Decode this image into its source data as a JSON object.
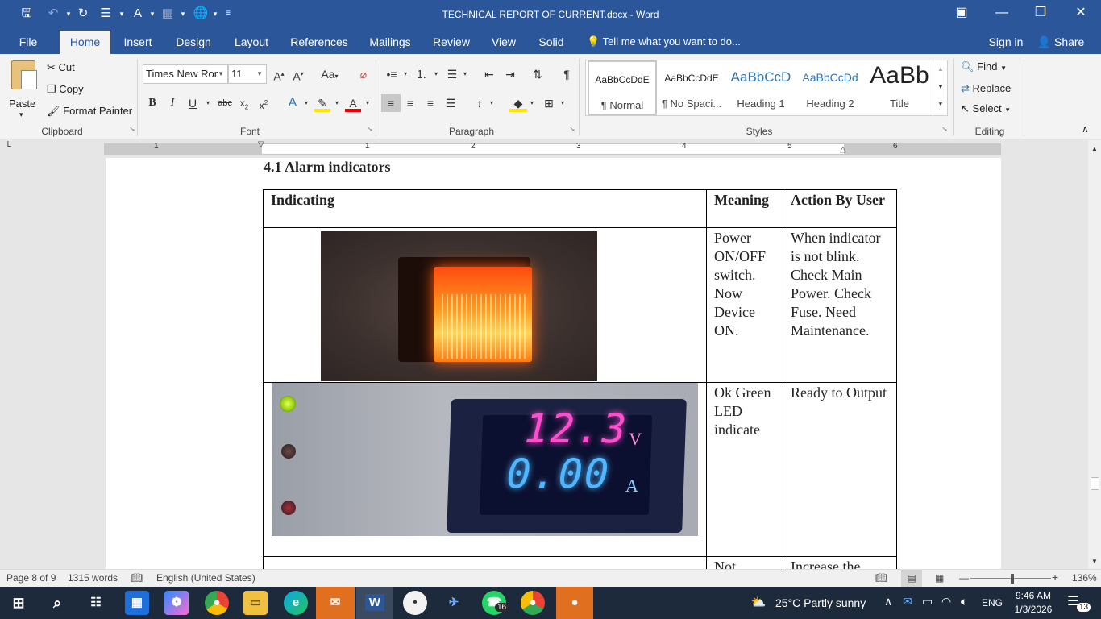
{
  "window": {
    "title": "TECHNICAL REPORT OF CURRENT.docx - Word"
  },
  "tabs": [
    "File",
    "Home",
    "Insert",
    "Design",
    "Layout",
    "References",
    "Mailings",
    "Review",
    "View",
    "Solid"
  ],
  "tell_me": "Tell me what you want to do...",
  "sign_in": "Sign in",
  "share": "Share",
  "clipboard": {
    "paste": "Paste",
    "cut": "Cut",
    "copy": "Copy",
    "format_painter": "Format Painter",
    "label": "Clipboard"
  },
  "font": {
    "name": "Times New Ror",
    "size": "11",
    "label": "Font"
  },
  "paragraph": {
    "label": "Paragraph"
  },
  "styles": {
    "label": "Styles",
    "items": [
      {
        "preview": "AaBbCcDdE",
        "name": "¶ Normal"
      },
      {
        "preview": "AaBbCcDdE",
        "name": "¶ No Spaci..."
      },
      {
        "preview": "AaBbCcD",
        "name": "Heading 1"
      },
      {
        "preview": "AaBbCcDd",
        "name": "Heading 2"
      },
      {
        "preview": "AaBb",
        "name": "Title"
      }
    ]
  },
  "editing": {
    "find": "Find",
    "replace": "Replace",
    "select": "Select",
    "label": "Editing"
  },
  "ruler": [
    "1",
    "1",
    "2",
    "3",
    "4",
    "5",
    "6"
  ],
  "document": {
    "heading": "4.1  Alarm indicators",
    "table": {
      "headers": [
        "Indicating",
        "Meaning",
        "Action By User"
      ],
      "rows": [
        {
          "meaning": "Power ON/OFF switch. Now Device ON.",
          "action": "When indicator is not blink. Check Main Power. Check Fuse. Need Maintenance."
        },
        {
          "meaning": "Ok Green LED indicate",
          "action": "Ready to Output",
          "display_voltage": "12.3",
          "display_current": "0.00",
          "unit_v": "V",
          "unit_a": "A"
        },
        {
          "meaning": "Not",
          "action": "Increase the"
        }
      ]
    }
  },
  "status": {
    "page": "Page 8 of 9",
    "words": "1315 words",
    "language": "English (United States)",
    "zoom": "136%"
  },
  "taskbar": {
    "weather": "25°C  Partly sunny",
    "lang": "ENG",
    "time": "9:46 AM",
    "date": "1/3/2026",
    "whatsapp_badge": "16",
    "notif_count": "13"
  }
}
